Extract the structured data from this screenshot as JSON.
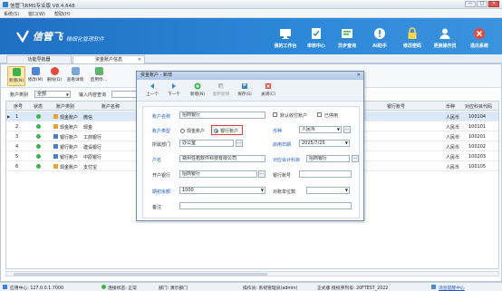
{
  "window": {
    "title": "信管飞RMS专业版 V8.4.648",
    "min": "—",
    "max": "□",
    "close": "✕"
  },
  "menu": [
    "系统(S)",
    "窗口(W)",
    "帮助(H)"
  ],
  "banner": {
    "brand": "信管飞",
    "slogan": "精细化管理软件",
    "buttons": [
      {
        "label": "我的工作台",
        "icon": "desktop-icon"
      },
      {
        "label": "审核中心",
        "icon": "approval-icon"
      },
      {
        "label": "异步查询",
        "icon": "async-query-icon"
      },
      {
        "label": "AI助手",
        "icon": "ai-assistant-icon"
      },
      {
        "label": "修改密码",
        "icon": "lock-icon"
      },
      {
        "label": "更换操作员",
        "icon": "switch-user-icon"
      },
      {
        "label": "退出系统",
        "icon": "exit-icon"
      }
    ]
  },
  "tabs": [
    {
      "label": "功能导航器",
      "closable": false
    },
    {
      "label": "资金账户信息",
      "closable": true,
      "close": "✕"
    }
  ],
  "toolbar": [
    {
      "label": "新增(N)",
      "icon": "add-icon"
    },
    {
      "label": "修改(M)",
      "icon": "edit-icon"
    },
    {
      "label": "删除(D)",
      "icon": "delete-icon"
    },
    {
      "label": "查看详情",
      "icon": "details-icon"
    },
    {
      "label": "启用停…",
      "icon": "toggle-icon"
    }
  ],
  "filter": {
    "type_label": "账户类别",
    "type_value": "全部",
    "query_label": "输入内容查询"
  },
  "grid": {
    "headers": [
      "序号",
      "状态",
      "账户类别",
      "账户名称",
      "银行账号",
      "币种",
      "对应科目代码"
    ],
    "rows": [
      {
        "no": "1",
        "type": "现金账户",
        "name": "微信",
        "currency": "人民币",
        "code": "100104",
        "type_icon": "cash-account-icon"
      },
      {
        "no": "2",
        "type": "现金账户",
        "name": "现金",
        "currency": "人民币",
        "code": "100101",
        "type_icon": "cash-account-icon"
      },
      {
        "no": "3",
        "type": "银行账户",
        "name": "工商银行",
        "currency": "人民币",
        "code": "100201",
        "type_icon": "bank-account-icon"
      },
      {
        "no": "4",
        "type": "银行账户",
        "name": "建设银行",
        "currency": "人民币",
        "code": "100202",
        "type_icon": "bank-account-icon"
      },
      {
        "no": "5",
        "type": "银行账户",
        "name": "中原银行",
        "currency": "人民币",
        "code": "100203",
        "type_icon": "bank-account-icon"
      },
      {
        "no": "6",
        "type": "现金账户",
        "name": "支付宝",
        "currency": "人民币",
        "code": "100105",
        "type_icon": "cash-account-icon"
      }
    ]
  },
  "dialog": {
    "title": "资金账户 - 新增",
    "close": "✕",
    "tools": [
      {
        "label": "上一个",
        "icon": "prev-icon"
      },
      {
        "label": "下一个",
        "icon": "next-icon"
      },
      {
        "label": "新增(N)",
        "icon": "add-icon"
      },
      {
        "label": "复制新增",
        "icon": "copy-add-icon"
      },
      {
        "label": "保存(S)",
        "icon": "save-icon"
      },
      {
        "label": "关闭(C)",
        "icon": "close-icon"
      }
    ],
    "form": {
      "name_label": "账户名称",
      "name_value": "招商银行",
      "default_label": "默认收付账户",
      "disabled_label": "已停用",
      "type_label": "账户类型",
      "type_cash": "现金账户",
      "type_bank": "银行账户",
      "currency_label": "币种",
      "currency_value": "人民币",
      "dept_label": "所属部门",
      "dept_value": "办公室",
      "date_label": "启用日期",
      "date_value": "2025/7/25",
      "holder_label": "户名",
      "holder_value": "郑州任拓软件科技有限公司",
      "subject_label": "对应会计科目",
      "subject_value": "招商银行",
      "bank_label": "开户银行",
      "bank_value": "招商银行",
      "account_label": "银行账号",
      "account_value": "",
      "balance_label": "期初余额",
      "balance_value": "1000",
      "unit_label": "对账单位数",
      "unit_value": "",
      "remark_label": "备注",
      "remark_value": ""
    }
  },
  "status": {
    "center": "应用中心: 127.0.0.1:7000",
    "conn": "连接状态: 正常",
    "dept": "部门: 演示部门",
    "operator": "操作员: 系统管理员(admin)",
    "license": "正式版  授权序列号: 20FTEST_2022",
    "message": "消息提醒中心"
  },
  "colors": {
    "banner": "#2c86d8",
    "label_blue": "#1d57c8",
    "highlight": "#e03b3b",
    "status_ok": "#3bb54a"
  }
}
